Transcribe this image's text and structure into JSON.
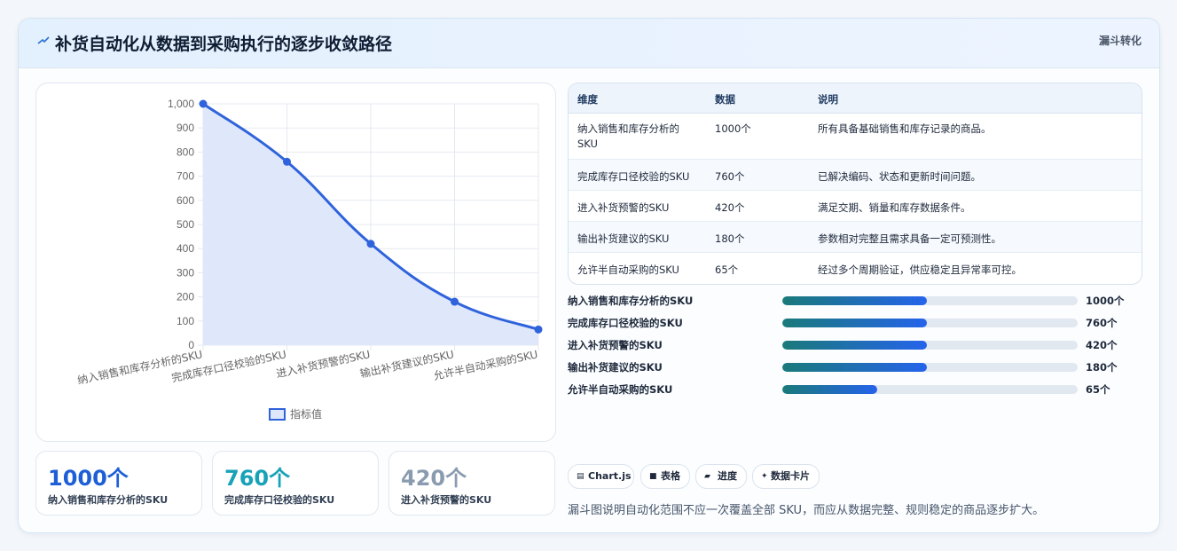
{
  "header": {
    "title": "补货自动化从数据到采购执行的逐步收敛路径",
    "tag": "漏斗转化"
  },
  "chart_data": {
    "type": "line",
    "categories": [
      "纳入销售和库存分析的SKU",
      "完成库存口径校验的SKU",
      "进入补货预警的SKU",
      "输出补货建议的SKU",
      "允许半自动采购的SKU"
    ],
    "series": [
      {
        "name": "指标值",
        "values": [
          1000,
          760,
          420,
          180,
          65
        ]
      }
    ],
    "yticks": [
      "0",
      "100",
      "200",
      "300",
      "400",
      "500",
      "600",
      "700",
      "800",
      "900",
      "1,000"
    ],
    "ylim": [
      0,
      1000
    ],
    "fill": "area",
    "grid": true,
    "legend": "bottom",
    "colors": {
      "line": "#2f63dc",
      "fill": "#dfe8fb",
      "grid": "#e5e9f0"
    }
  },
  "kpis": [
    {
      "value": "1000个",
      "label": "纳入销售和库存分析的SKU",
      "color": "#1d5fd6"
    },
    {
      "value": "760个",
      "label": "完成库存口径校验的SKU",
      "color": "#17a2b8"
    },
    {
      "value": "420个",
      "label": "进入补货预警的SKU",
      "color": "#8a9bb0"
    }
  ],
  "table": {
    "headers": [
      "维度",
      "数据",
      "说明"
    ],
    "rows": [
      {
        "dim": "纳入销售和库存分析的",
        "dim2": "SKU",
        "val": "1000个",
        "desc": "所有具备基础销售和库存记录的商品。"
      },
      {
        "dim": "完成库存口径校验的SKU",
        "val": "760个",
        "desc": "已解决编码、状态和更新时间问题。"
      },
      {
        "dim": "进入补货预警的SKU",
        "val": "420个",
        "desc": "满足交期、销量和库存数据条件。"
      },
      {
        "dim": "输出补货建议的SKU",
        "val": "180个",
        "desc": "参数相对完整且需求具备一定可预测性。"
      },
      {
        "dim": "允许半自动采购的SKU",
        "val": "65个",
        "desc": "经过多个周期验证，供应稳定且异常率可控。"
      }
    ]
  },
  "progress": [
    {
      "label": "纳入销售和库存分析的SKU",
      "value": "1000个",
      "fill": 0.49
    },
    {
      "label": "完成库存口径校验的SKU",
      "value": "760个",
      "fill": 0.49
    },
    {
      "label": "进入补货预警的SKU",
      "value": "420个",
      "fill": 0.49
    },
    {
      "label": "输出补货建议的SKU",
      "value": "180个",
      "fill": 0.49
    },
    {
      "label": "允许半自动采购的SKU",
      "value": "65个",
      "fill": 0.32
    }
  ],
  "chips": [
    {
      "icon": "chart-icon",
      "label": "Chart.js"
    },
    {
      "icon": "table-icon",
      "label": "表格"
    },
    {
      "icon": "progress-icon",
      "label": "进度"
    },
    {
      "icon": "sparkle-icon",
      "label": "数据卡片"
    }
  ],
  "footer": "漏斗图说明自动化范围不应一次覆盖全部 SKU，而应从数据完整、规则稳定的商品逐步扩大。"
}
